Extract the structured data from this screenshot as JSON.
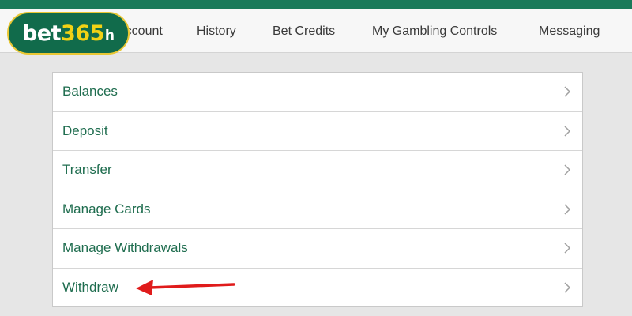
{
  "logo": {
    "text_white": "bet",
    "text_yellow": "365",
    "text_suffix": "h",
    "colors": {
      "bg": "#116b4b",
      "border": "#e9c733",
      "yellow": "#f3d215"
    }
  },
  "nav": {
    "items": [
      {
        "label": "Account"
      },
      {
        "label": "History"
      },
      {
        "label": "Bet Credits"
      },
      {
        "label": "My Gambling Controls"
      },
      {
        "label": "Messaging"
      }
    ]
  },
  "menu": {
    "items": [
      {
        "label": "Balances",
        "icon": "chevron-right-icon"
      },
      {
        "label": "Deposit",
        "icon": "chevron-right-icon"
      },
      {
        "label": "Transfer",
        "icon": "chevron-right-icon"
      },
      {
        "label": "Manage Cards",
        "icon": "chevron-right-icon"
      },
      {
        "label": "Manage Withdrawals",
        "icon": "chevron-right-icon"
      },
      {
        "label": "Withdraw",
        "icon": "chevron-right-icon"
      }
    ]
  },
  "annotation": {
    "icon": "red-arrow-icon",
    "color": "#e01b1b"
  },
  "colors": {
    "brand_green": "#1a7a5a",
    "link_green": "#1f6d4f",
    "page_bg": "#e6e6e6"
  }
}
